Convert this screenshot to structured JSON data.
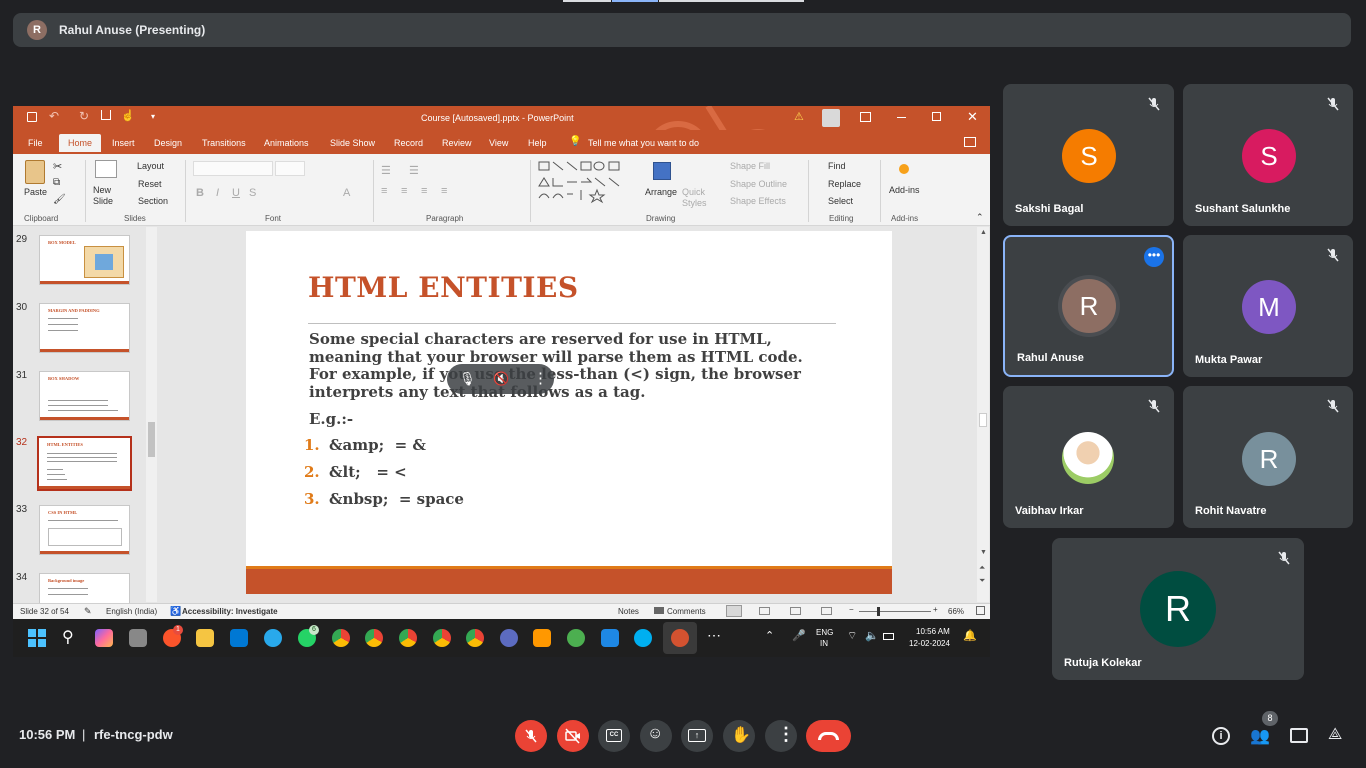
{
  "meet": {
    "presenter_initial": "R",
    "presenter_label": "Rahul Anuse (Presenting)",
    "time": "10:56 PM",
    "separator": "|",
    "meeting_code": "rfe-tncg-pdw",
    "people_count": "8"
  },
  "ppt": {
    "window_title": "Course [Autosaved].pptx  -  PowerPoint",
    "tabs": [
      "File",
      "Home",
      "Insert",
      "Design",
      "Transitions",
      "Animations",
      "Slide Show",
      "Record",
      "Review",
      "View",
      "Help"
    ],
    "tell_me": "Tell me what you want to do",
    "ribbon": {
      "paste": "Paste",
      "new_slide": "New Slide",
      "layout": "Layout",
      "reset": "Reset",
      "section": "Section",
      "arrange": "Arrange",
      "quick_styles": "Quick Styles",
      "shape_fill": "Shape Fill",
      "shape_outline": "Shape Outline",
      "shape_effects": "Shape Effects",
      "find": "Find",
      "replace": "Replace",
      "select": "Select",
      "addins": "Add-ins",
      "groups": {
        "clipboard": "Clipboard",
        "slides": "Slides",
        "font": "Font",
        "paragraph": "Paragraph",
        "drawing": "Drawing",
        "editing": "Editing",
        "addins": "Add-ins"
      }
    },
    "thumbnails": [
      {
        "num": "29",
        "title": "BOX MODEL"
      },
      {
        "num": "30",
        "title": "MARGIN AND PADDING"
      },
      {
        "num": "31",
        "title": "BOX SHADOW"
      },
      {
        "num": "32",
        "title": "HTML ENTITIES"
      },
      {
        "num": "33",
        "title": "CSS IN HTML"
      },
      {
        "num": "34",
        "title": "Background image"
      }
    ],
    "slide": {
      "title": "HTML ENTITIES",
      "body": "Some special characters are reserved for use in HTML, meaning that your browser will parse them as HTML code. For example, if you use the less-than (<) sign, the browser interprets any text that follows as a tag.",
      "eg": "E.g.:-",
      "items": [
        {
          "n": "1.",
          "text": "&amp;  = &"
        },
        {
          "n": "2.",
          "text": "&lt;   = <"
        },
        {
          "n": "3.",
          "text": "&nbsp;  = space"
        }
      ]
    },
    "status": {
      "slide": "Slide 32 of 54",
      "lang": "English (India)",
      "accessibility": "Accessibility: Investigate",
      "notes": "Notes",
      "comments": "Comments",
      "zoom": "66%"
    }
  },
  "taskbar": {
    "lang1": "ENG",
    "lang2": "IN",
    "clock": "10:56 AM",
    "date": "12-02-2024",
    "whatsapp_badge": "6",
    "chrome_badge": "1"
  },
  "participants": [
    {
      "initial": "S",
      "name": "Sakshi Bagal",
      "color": "#f57c00",
      "muted": true
    },
    {
      "initial": "S",
      "name": "Sushant Salunkhe",
      "color": "#d81b60",
      "muted": true
    },
    {
      "initial": "R",
      "name": "Rahul Anuse",
      "color": "#8d6e63",
      "muted": false
    },
    {
      "initial": "M",
      "name": "Mukta Pawar",
      "color": "#7e57c2",
      "muted": true
    },
    {
      "initial": "",
      "name": "Vaibhav Irkar",
      "color": "#aed581",
      "muted": true
    },
    {
      "initial": "R",
      "name": "Rohit Navatre",
      "color": "#78909c",
      "muted": true
    },
    {
      "initial": "R",
      "name": "Rutuja Kolekar",
      "color": "#004d40",
      "muted": true
    }
  ],
  "colors": {
    "accent_orange": "#c5522a",
    "meet_red": "#ea4335",
    "meet_bg": "#202124",
    "tile_bg": "#3c4043"
  }
}
